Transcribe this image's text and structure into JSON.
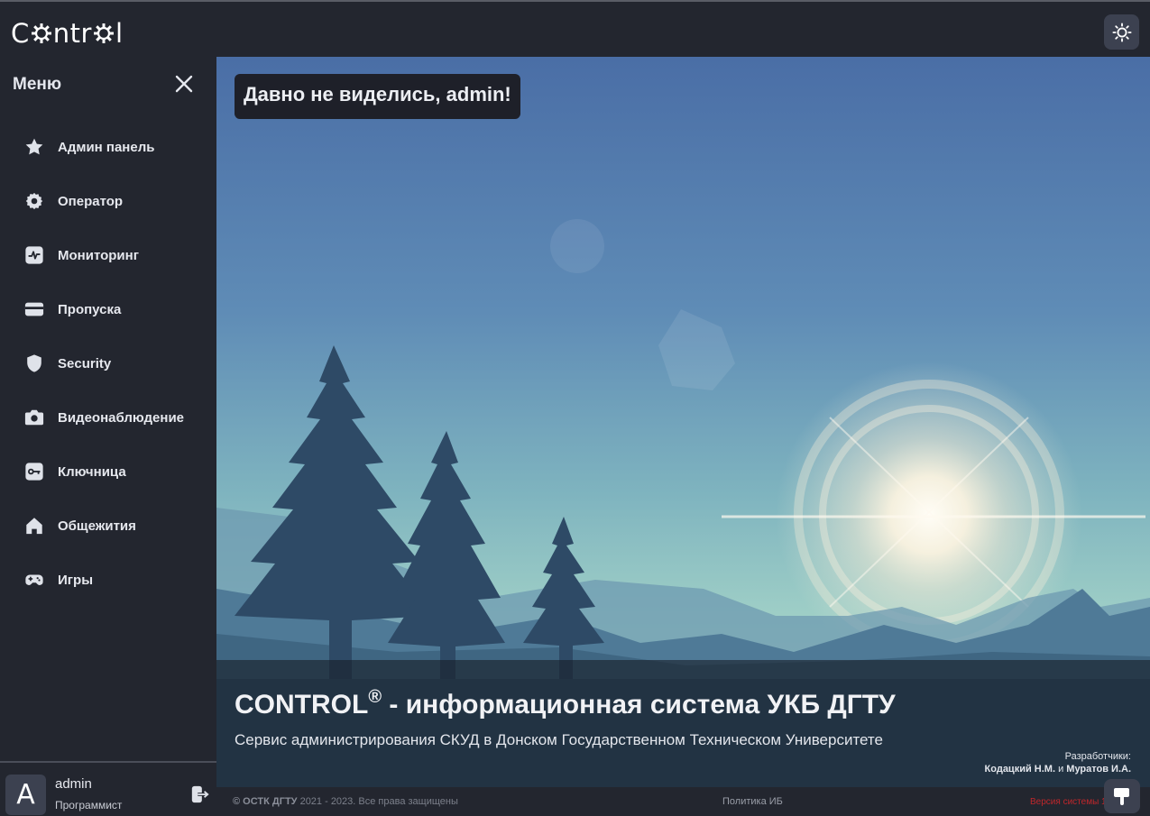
{
  "app": {
    "logo_text_before": "C",
    "logo_text_middle": "ntr",
    "logo_text_after": "l",
    "logo_full": "Control"
  },
  "topbar": {
    "theme_toggle_icon": "sun-icon"
  },
  "sidebar": {
    "title": "Меню",
    "close_icon": "close-icon",
    "items": [
      {
        "label": "Админ панель",
        "icon": "star-icon"
      },
      {
        "label": "Оператор",
        "icon": "gear-icon"
      },
      {
        "label": "Мониторинг",
        "icon": "pulse-icon"
      },
      {
        "label": "Пропуска",
        "icon": "card-icon"
      },
      {
        "label": "Security",
        "icon": "shield-icon"
      },
      {
        "label": "Видеонаблюдение",
        "icon": "camera-icon"
      },
      {
        "label": "Ключница",
        "icon": "key-icon"
      },
      {
        "label": "Общежития",
        "icon": "home-icon"
      },
      {
        "label": "Игры",
        "icon": "gamepad-icon"
      }
    ],
    "user": {
      "avatar_letter": "A",
      "name": "admin",
      "role": "Программист"
    }
  },
  "hero": {
    "greeting": "Давно не виделись, admin!",
    "title": "CONTROL",
    "title_mark": "®",
    "title_rest": " - информационная система УКБ ДГТУ",
    "subtitle": "Сервис администрирования СКУД в Донском Государственном Техническом Университете",
    "developers_label": "Разработчики:",
    "developer_1": "Кодацкий Н.М.",
    "developers_and": " и ",
    "developer_2": "Муратов И.А."
  },
  "footer": {
    "copyright_brand": "© ОСТК ДГТУ",
    "copyright_rest": " 2021 - 2023. Все права защищены",
    "policy": "Политика ИБ",
    "version": "Версия системы 1.",
    "help_icon": "pointer-icon"
  },
  "colors": {
    "background": "#23262f",
    "button_bg": "#3c4150",
    "version_red": "#c0262b"
  }
}
